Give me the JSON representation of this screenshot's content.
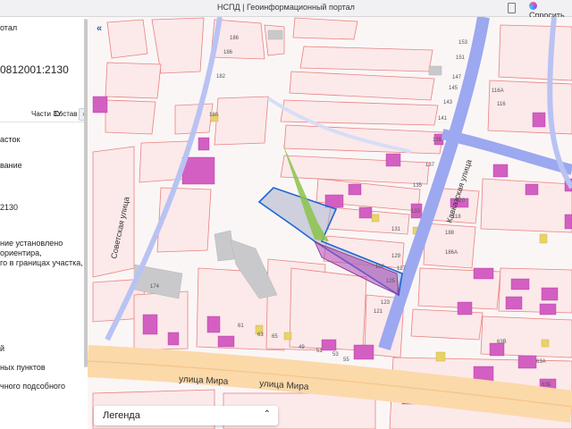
{
  "browser": {
    "title": "НСПД | Геоинформационный портал",
    "ai_label": "Спросить"
  },
  "panel": {
    "header": "отал",
    "cadastral_number": "0812001:2130",
    "tabs": [
      "Части ЗУ",
      "Состав"
    ],
    "lines": [
      "асток",
      "вание",
      "2130",
      "ние установлено",
      "ориентира,",
      "го в границах участка,",
      "й",
      "ных пунктов",
      "чного подсобного"
    ]
  },
  "legend": {
    "label": "Легенда"
  },
  "streets": {
    "mira": "улица Мира",
    "mira2": "улица Мира",
    "sovetskaya": "Советская улица",
    "kavkazskaya": "Кавказская улица"
  },
  "house_numbers": [
    "186",
    "186",
    "182",
    "180",
    "153",
    "151",
    "147",
    "145",
    "116А",
    "116",
    "143",
    "141",
    "139",
    "137",
    "135",
    "133",
    "131",
    "129",
    "127",
    "125",
    "123",
    "121",
    "120",
    "118",
    "100",
    "188",
    "186А",
    "174",
    "61",
    "63",
    "65",
    "49",
    "51",
    "53",
    "55",
    "63В",
    "63А",
    "63Б"
  ]
}
